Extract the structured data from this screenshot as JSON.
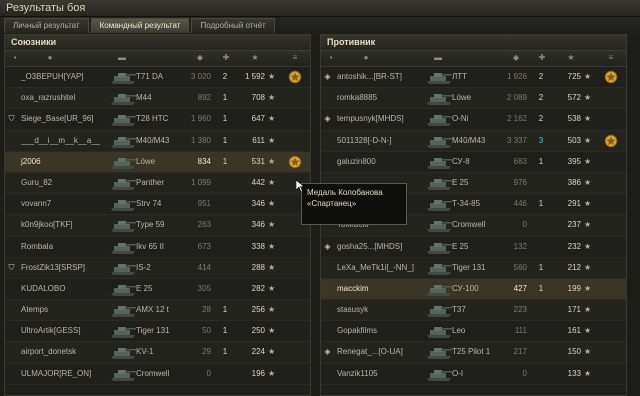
{
  "window_title": "Результаты боя",
  "tabs": [
    {
      "label": "Личный результат",
      "active": false
    },
    {
      "label": "Командный результат",
      "active": true
    },
    {
      "label": "Подробный отчёт",
      "active": false
    }
  ],
  "allies": {
    "title": "Союзники",
    "rows": [
      {
        "clan_icon": false,
        "name": "_O3BEPUH[YAP]",
        "tank": "T71 DA",
        "xp": "3 020",
        "kills": "2",
        "damage": "1 592",
        "medal": true
      },
      {
        "clan_icon": false,
        "name": "oxa_razrushitel",
        "tank": "M44",
        "xp": "892",
        "kills": "1",
        "damage": "708",
        "medal": false
      },
      {
        "clan_icon": true,
        "name": "Siege_Base[UR_96]",
        "tank": "T28 HTC",
        "xp": "1 960",
        "kills": "1",
        "damage": "647",
        "medal": false
      },
      {
        "clan_icon": false,
        "name": "___d__i__m__k__a__",
        "tank": "M40/M43",
        "xp": "1 380",
        "kills": "1",
        "damage": "611",
        "medal": false
      },
      {
        "clan_icon": false,
        "name": "j2006",
        "tank": "Löwe",
        "xp": "834",
        "kills": "1",
        "damage": "531",
        "medal": true,
        "highlight": true
      },
      {
        "clan_icon": false,
        "name": "Guru_82",
        "tank": "Panther",
        "xp": "1 099",
        "kills": "",
        "damage": "442",
        "medal": false
      },
      {
        "clan_icon": false,
        "name": "vovann7",
        "tank": "Strv 74",
        "xp": "951",
        "kills": "",
        "damage": "346",
        "medal": false
      },
      {
        "clan_icon": false,
        "name": "k0n9jkoo[TKF]",
        "tank": "Type 59",
        "xp": "263",
        "kills": "",
        "damage": "346",
        "medal": false
      },
      {
        "clan_icon": false,
        "name": "Rombala",
        "tank": "Ikv 65 II",
        "xp": "673",
        "kills": "",
        "damage": "338",
        "medal": false
      },
      {
        "clan_icon": true,
        "name": "FrostZik13[SRSP]",
        "tank": "IS-2",
        "xp": "414",
        "kills": "",
        "damage": "288",
        "medal": false
      },
      {
        "clan_icon": false,
        "name": "KUDALOBO",
        "tank": "E 25",
        "xp": "305",
        "kills": "",
        "damage": "282",
        "medal": false
      },
      {
        "clan_icon": false,
        "name": "Atemps",
        "tank": "AMX 12 t",
        "xp": "28",
        "kills": "1",
        "damage": "256",
        "medal": false
      },
      {
        "clan_icon": false,
        "name": "UltroArtik[GESS]",
        "tank": "Tiger 131",
        "xp": "50",
        "kills": "1",
        "damage": "250",
        "medal": false
      },
      {
        "clan_icon": false,
        "name": "airport_donetsk",
        "tank": "KV-1",
        "xp": "29",
        "kills": "1",
        "damage": "224",
        "medal": false
      },
      {
        "clan_icon": false,
        "name": "ULMAJOR[RE_ON]",
        "tank": "Cromwell",
        "xp": "0",
        "kills": "",
        "damage": "196",
        "medal": false
      }
    ]
  },
  "enemies": {
    "title": "Противник",
    "rows": [
      {
        "clan_icon": true,
        "name": "antoshik...[BR-ST]",
        "tank": "ЛТТ",
        "xp": "1 926",
        "kills": "2",
        "damage": "725",
        "medal": true
      },
      {
        "clan_icon": false,
        "name": "romka8885",
        "tank": "Löwe",
        "xp": "2 089",
        "kills": "2",
        "damage": "572",
        "medal": false
      },
      {
        "clan_icon": true,
        "name": "tempusnyk[MHDS]",
        "tank": "O-Ni",
        "xp": "2 162",
        "kills": "2",
        "damage": "538",
        "medal": false
      },
      {
        "clan_icon": false,
        "name": "5011328[-D-N-]",
        "tank": "M40/M43",
        "xp": "3 337",
        "kills": "3",
        "damage": "503",
        "medal": true
      },
      {
        "clan_icon": false,
        "name": "galuzin800",
        "tank": "СУ-8",
        "xp": "683",
        "kills": "1",
        "damage": "395",
        "medal": false
      },
      {
        "clan_icon": false,
        "name": "",
        "tank": "E 25",
        "xp": "976",
        "kills": "",
        "damage": "386",
        "medal": false
      },
      {
        "clan_icon": false,
        "name": "",
        "tank": "Т-34-85",
        "xp": "446",
        "kills": "1",
        "damage": "291",
        "medal": false
      },
      {
        "clan_icon": false,
        "name": "Toxirbekr",
        "tank": "Cromwell",
        "xp": "0",
        "kills": "",
        "damage": "237",
        "medal": false
      },
      {
        "clan_icon": true,
        "name": "gosha25...[MHDS]",
        "tank": "E 25",
        "xp": "132",
        "kills": "",
        "damage": "232",
        "medal": false
      },
      {
        "clan_icon": false,
        "name": "LeXa_MeTk1i[_-NN_]",
        "tank": "Tiger 131",
        "xp": "560",
        "kills": "1",
        "damage": "212",
        "medal": false
      },
      {
        "clan_icon": false,
        "name": "macckim",
        "tank": "СУ-100",
        "xp": "427",
        "kills": "1",
        "damage": "199",
        "medal": false,
        "highlight": true
      },
      {
        "clan_icon": false,
        "name": "stasusyk",
        "tank": "T37",
        "xp": "223",
        "kills": "",
        "damage": "171",
        "medal": false
      },
      {
        "clan_icon": false,
        "name": "Gopakfilms",
        "tank": "Leo",
        "xp": "111",
        "kills": "",
        "damage": "161",
        "medal": false
      },
      {
        "clan_icon": true,
        "name": "Renegat_...[O-UA]",
        "tank": "T25 Pilot 1",
        "xp": "217",
        "kills": "",
        "damage": "150",
        "medal": false
      },
      {
        "clan_icon": false,
        "name": "Vanzik1105",
        "tank": "O-I",
        "xp": "0",
        "kills": "",
        "damage": "133",
        "medal": false
      }
    ]
  },
  "tooltip": {
    "line1": "Медаль Колобанова",
    "line2": "«Спартанец»"
  },
  "colors": {
    "accent": "#dcd6bd",
    "cyan": "#4ec8d4",
    "medal": "#d7a13a"
  }
}
